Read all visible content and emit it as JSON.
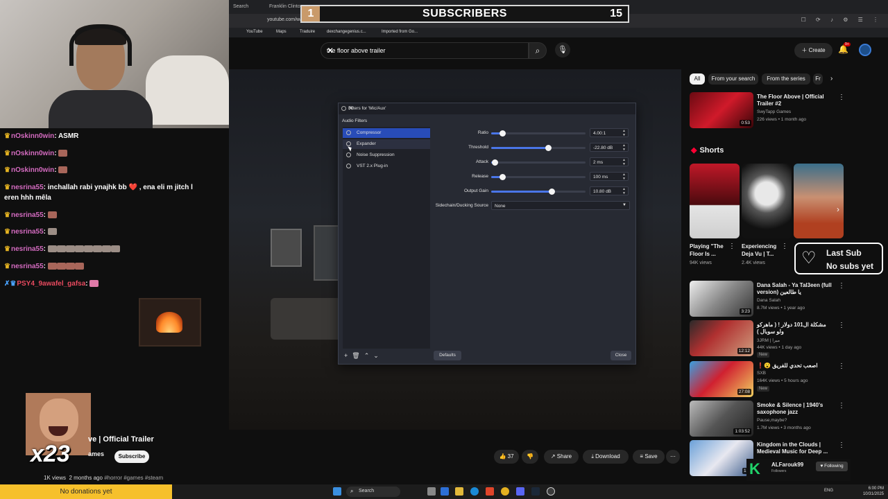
{
  "browser": {
    "tab_text": "Franklin Clinton",
    "tab_search": "Search",
    "url": "youtube.com/watch?v=AVNJbbKQydc",
    "bookmarks": [
      "YouTube",
      "Maps",
      "Traduire",
      "dexchangegenius.c...",
      "Imported from Go..."
    ]
  },
  "subscribers_overlay": {
    "rank": "1",
    "label": "SUBSCRIBERS",
    "count": "15"
  },
  "youtube": {
    "search_query": "the floor above trailer",
    "create_label": "Create",
    "notif_count": "9+",
    "video": {
      "title_visible": "ve | Official Trailer",
      "channel_visible": "ames",
      "subscribe_label": "Subscribe",
      "likes": "37",
      "share_label": "Share",
      "download_label": "Download",
      "save_label": "Save",
      "views": "1K views",
      "age": "2 months ago",
      "tags": "#horror #games #steam"
    },
    "chips": [
      "All",
      "From your search",
      "From the series",
      "Fr"
    ],
    "shorts_heading": "Shorts",
    "shorts": [
      {
        "title": "Playing \"The Floor Is ...",
        "views": "94K views"
      },
      {
        "title": "Experiencing Deja Vu | T...",
        "views": "2.4K views"
      },
      {
        "title": "",
        "views": ""
      }
    ],
    "recommendations": [
      {
        "title": "The Floor Above | Official Trailer #2",
        "channel": "SwyTapp Games",
        "stats": "226 views • 1 month ago",
        "duration": "0:53",
        "badge": ""
      },
      {
        "title": "Dana Salah - Ya Tal3een (full version) يا طالعين",
        "channel": "Dana Salah",
        "stats": "8.7M views • 1 year ago",
        "duration": "3:23",
        "badge": ""
      },
      {
        "title": "مشكلة ال101 دولار ! ( ماهركو ولو سوبال )",
        "channel": "3JRM | ميرا",
        "stats": "44K views • 1 day ago",
        "duration": "12:12",
        "badge": "New"
      },
      {
        "title": "❗😮 اصعب تحدي للفريق",
        "channel": "SXB",
        "stats": "164K views • 5 hours ago",
        "duration": "27:08",
        "badge": "New"
      },
      {
        "title": "Smoke & Silence  |  1940's saxophone jazz",
        "channel": "Pause,maybe?",
        "stats": "1.7M views • 3 months ago",
        "duration": "1:03:52",
        "badge": ""
      },
      {
        "title": "Kingdom in the Clouds | Medieval Music for Deep ...",
        "channel": "",
        "stats": "",
        "duration": "1:3",
        "badge": ""
      }
    ]
  },
  "obs": {
    "window_title": "Filters for 'Mic/Aux'",
    "section_label": "Audio Filters",
    "filters": [
      "Compressor",
      "Expander",
      "Noise Suppression",
      "VST 2.x Plug-in"
    ],
    "selected_filter": "Compressor",
    "params": [
      {
        "label": "Ratio",
        "value": "4.00:1",
        "level": 0.12
      },
      {
        "label": "Threshold",
        "value": "-22.80 dB",
        "level": 0.6
      },
      {
        "label": "Attack",
        "value": "2 ms",
        "level": 0.04
      },
      {
        "label": "Release",
        "value": "100 ms",
        "level": 0.12
      },
      {
        "label": "Output Gain",
        "value": "10.80 dB",
        "level": 0.64
      }
    ],
    "sidechain_label": "Sidechain/Ducking Source",
    "sidechain_value": "None",
    "defaults_label": "Defaults",
    "close_label": "Close"
  },
  "chat": [
    {
      "user": "nOskinn0win",
      "msg": "ASMR",
      "emote": ""
    },
    {
      "user": "nOskinn0win",
      "msg": "",
      "emote": "emote"
    },
    {
      "user": "nOskinn0win",
      "msg": "",
      "emote": "emote"
    },
    {
      "user": "nesrina55",
      "msg": "inchallah rabi ynajhk bb ❤️ , ena eli m jitch l",
      "emote": ""
    },
    {
      "user": "",
      "msg": "eren hhh mêla",
      "emote": ""
    },
    {
      "user": "nesrina55",
      "msg": "",
      "emote": "emote"
    },
    {
      "user": "nesrina55",
      "msg": "",
      "emote": "gray"
    },
    {
      "user": "nesrina55",
      "msg": "",
      "emote": "gray-row"
    },
    {
      "user": "nesrina55",
      "msg": "",
      "emote": "row"
    },
    {
      "user": "PSY4_9awafel_gafsa",
      "msg": "",
      "emote": "pink"
    }
  ],
  "emote_multiplier": "x23",
  "last_sub": {
    "label": "Last Sub",
    "value": "No subs yet"
  },
  "donation_text": "No donations yet",
  "follower": {
    "name": "ALFarouk99",
    "sub": "Followers",
    "button": "♥ Following"
  },
  "taskbar": {
    "search_label": "Search",
    "lang": "ENG",
    "time": "6:00 PM",
    "date": "10/31/2025"
  },
  "colors": {
    "accent": "#284cb8",
    "donation": "#f6c02b",
    "yt_red": "#ff0033"
  }
}
